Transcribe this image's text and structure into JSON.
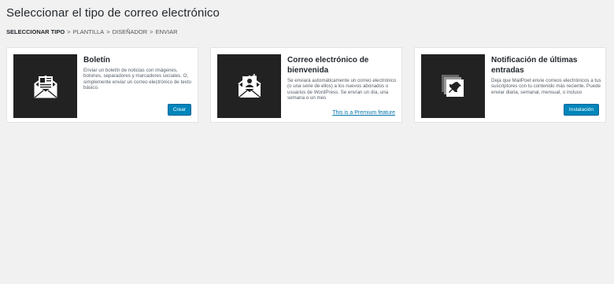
{
  "header": {
    "title": "Seleccionar el tipo de correo electrónico"
  },
  "breadcrumb": {
    "steps": [
      "SELECCIONAR TIPO",
      "PLANTILLA",
      "DISEÑADOR",
      "ENVIAR"
    ],
    "separator": ">"
  },
  "cards": [
    {
      "title": "Boletín",
      "description": "Enviar un boletín de noticias con imágenes, botones, separadores y marcadores sociales. O, simplemente enviar un correo electrónico de texto básico.",
      "action_label": "Crear",
      "icon": "newsletter-envelope-icon"
    },
    {
      "title": "Correo electrónico de bienvenida",
      "description": "Se enviará automáticamente un correo electrónico (o una serie de ellos) a los nuevos abonados o usuarios de WordPress. Se envían un día, una semana o un mes",
      "action_label": "This is a Premium feature",
      "icon": "welcome-user-envelope-icon"
    },
    {
      "title": "Notificación de últimas entradas",
      "description": "Deja que MailPoet envíe correos electrónicos a tus suscriptores con tu contenido más reciente. Puede enviar diaria, semanal, mensual, o incluso",
      "action_label": "Instalación",
      "icon": "post-notification-pin-icon"
    }
  ],
  "colors": {
    "background": "#f1f1f1",
    "thumb": "#222222",
    "primary_button": "#0085ba",
    "link": "#0073aa"
  }
}
